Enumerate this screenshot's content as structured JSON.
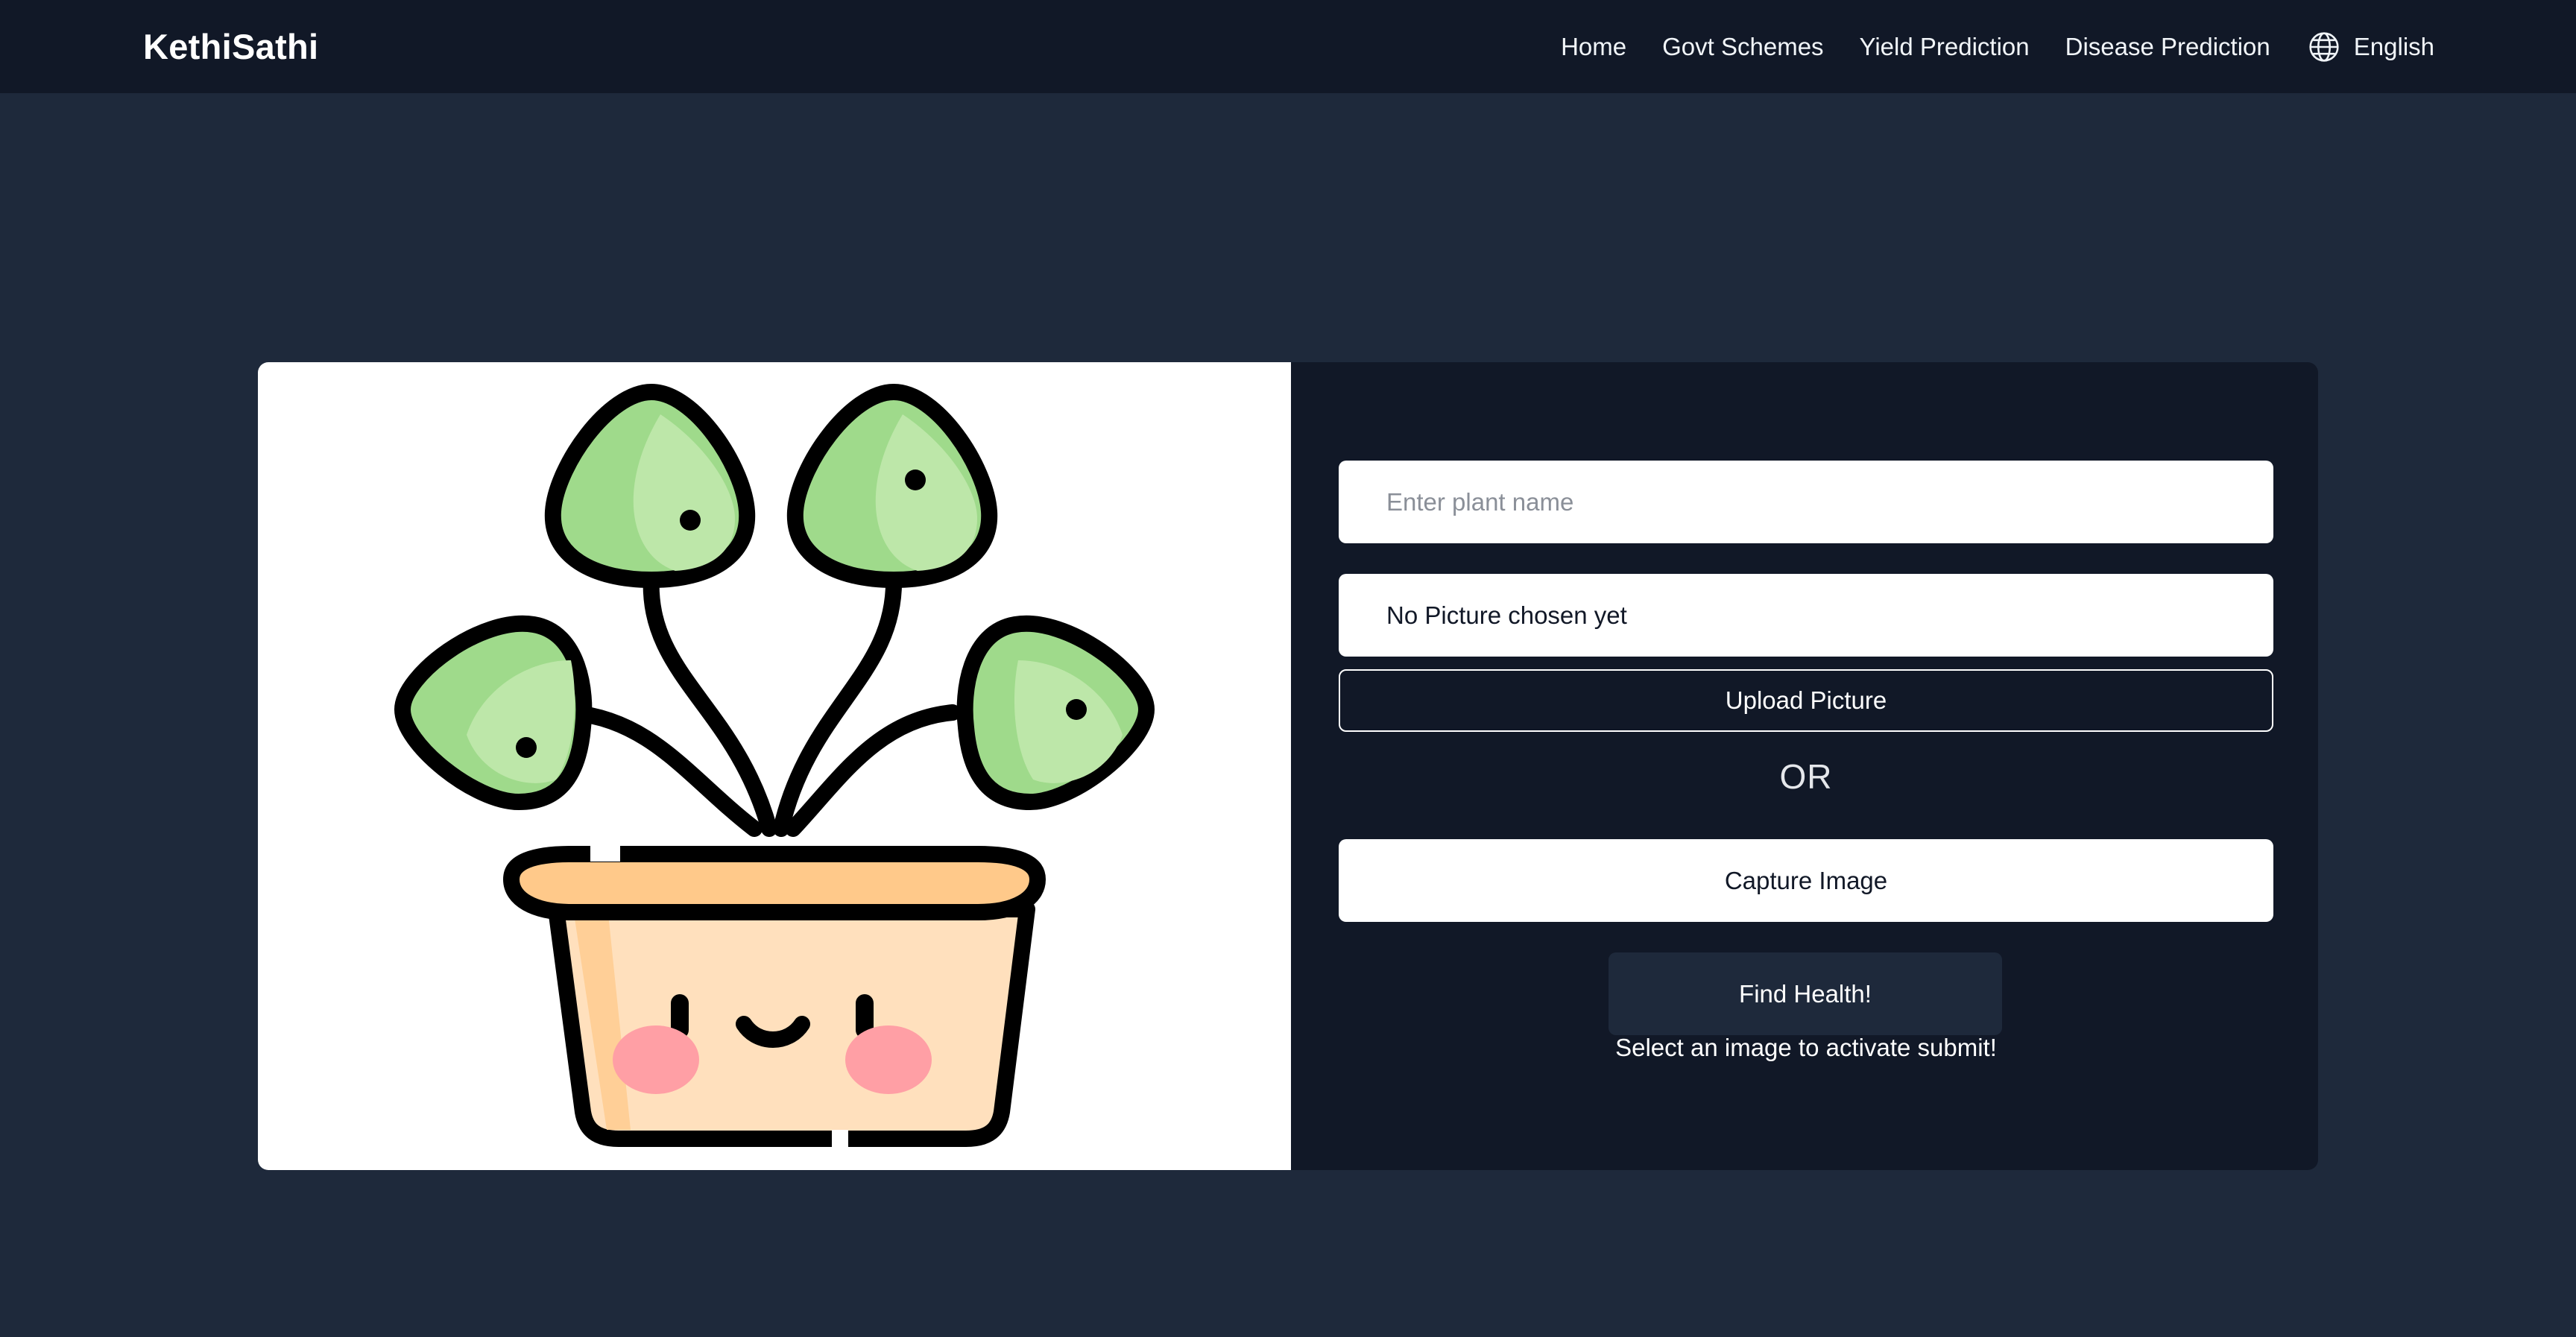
{
  "navbar": {
    "brand": "KethiSathi",
    "links": [
      "Home",
      "Govt Schemes",
      "Yield Prediction",
      "Disease Prediction"
    ],
    "language": "English",
    "language_icon": "globe-icon"
  },
  "illustration": {
    "icon": "potted-plant-illustration"
  },
  "form": {
    "plant_name_placeholder": "Enter plant name",
    "plant_name_value": "",
    "file_status": "No Picture chosen yet",
    "upload_label": "Upload Picture",
    "or_label": "OR",
    "capture_label": "Capture Image",
    "submit_label": "Find Health!",
    "hint": "Select an image to activate submit!"
  },
  "colors": {
    "navbar_bg": "#111827",
    "page_bg": "#1e293b",
    "form_bg": "#111827",
    "submit_bg": "#1e293b"
  }
}
